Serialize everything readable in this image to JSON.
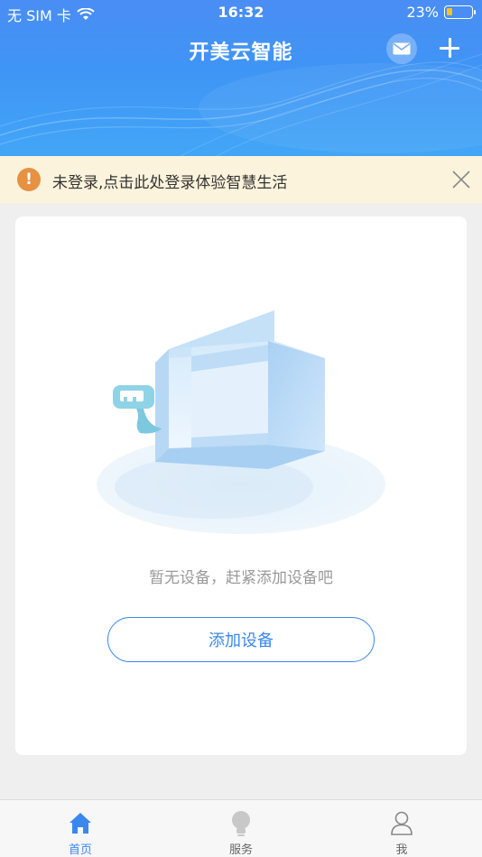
{
  "status_bar": {
    "carrier": "无 SIM 卡",
    "time": "16:32",
    "battery": "23%",
    "battery_level": 0.23
  },
  "header": {
    "title": "开美云智能",
    "message_icon": "mail-icon",
    "add_icon": "plus-icon"
  },
  "login_banner": {
    "text": "未登录,点击此处登录体验智慧生活",
    "warn_icon": "exclamation-icon",
    "close_icon": "close-icon"
  },
  "empty_state": {
    "illustration": "empty-box-illustration",
    "message": "暂无设备，赶紧添加设备吧",
    "button_label": "添加设备"
  },
  "tabbar": {
    "items": [
      {
        "label": "首页",
        "icon": "home-icon",
        "active": true
      },
      {
        "label": "服务",
        "icon": "lightbulb-icon",
        "active": false
      },
      {
        "label": "我",
        "icon": "person-icon",
        "active": false
      }
    ]
  },
  "colors": {
    "primary": "#3a88ee",
    "header_top": "#4a8df4",
    "banner_bg": "#fcf3dc",
    "warn": "#e79143",
    "battery_fill": "#f7c325"
  }
}
